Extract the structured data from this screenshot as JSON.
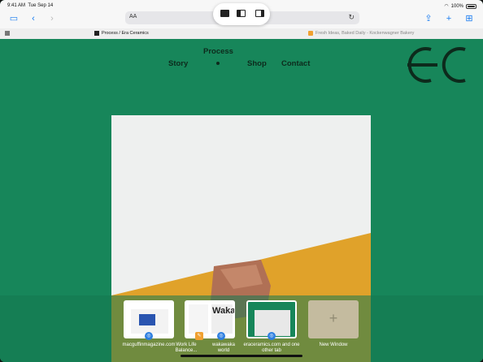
{
  "status_bar": {
    "time": "9:41 AM",
    "date": "Tue Sep 14",
    "battery": "100%"
  },
  "toolbar": {
    "sidebar_icon": "sidebar-icon",
    "back_icon": "chevron-left-icon",
    "forward_icon": "chevron-right-icon",
    "text_size": "AA",
    "share_icon": "share-icon",
    "new_tab_icon": "plus-icon",
    "tabs_icon": "tab-grid-icon"
  },
  "tabs": [
    {
      "title": "Process / Era Ceramics"
    },
    {
      "title": "Fresh Ideas, Baked Daily - Kockenwagner Bakery"
    }
  ],
  "site": {
    "nav": {
      "story": "Story",
      "process": "Process",
      "shop": "Shop",
      "contact": "Contact"
    },
    "logo_text": "EC"
  },
  "switcher": {
    "windows": [
      {
        "label": "macguffinmagazine.com"
      },
      {
        "label": "Work Life Balance..."
      },
      {
        "label": "wakawaka world"
      },
      {
        "label": "eraceramics.com and one other tab"
      }
    ],
    "new_window_label": "New Window"
  },
  "colors": {
    "brand_green": "#17865a",
    "ochre": "#e0a22a",
    "clay": "#b07055"
  }
}
